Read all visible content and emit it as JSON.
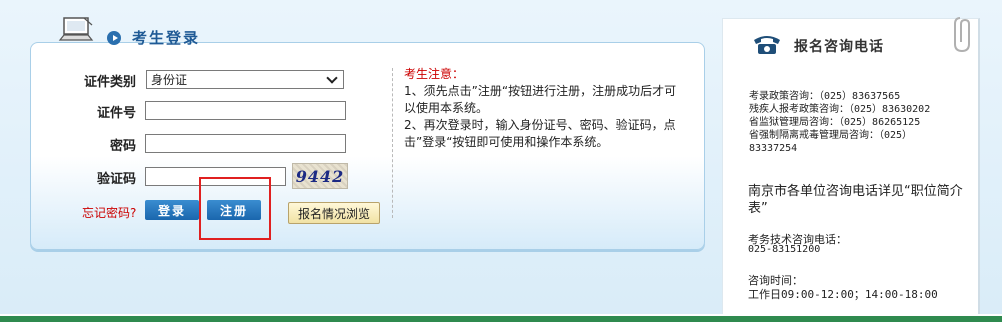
{
  "login": {
    "title": "考生登录",
    "fields": {
      "id_type_label": "证件类别",
      "id_type_value": "身份证",
      "id_number_label": "证件号",
      "password_label": "密码",
      "captcha_label": "验证码",
      "captcha_text": "9442"
    },
    "forgot_password": "忘记密码?",
    "login_button": "登录",
    "register_button": "注册",
    "browse_button": "报名情况浏览"
  },
  "notice": {
    "title": "考生注意：",
    "line1": "1、须先点击”注册“按钮进行注册，注册成功后才可以使用本系统。",
    "line2": "2、再次登录时，输入身份证号、密码、验证码，点击”登录“按钮即可使用和操作本系统。"
  },
  "contact": {
    "title": "报名咨询电话",
    "lines": [
      "考录政策咨询：（025）83637565",
      "残疾人报考政策咨询：（025）83630202",
      "省监狱管理局咨询：（025）86265125",
      "省强制隔离戒毒管理局咨询：（025）",
      "83337254"
    ],
    "note": "南京市各单位咨询电话详见“职位简介表”",
    "tech_label": "考务技术咨询电话：",
    "tech_phone": "025-83151200",
    "time_label": "咨询时间：",
    "time_value": "工作日09:00-12:00；14:00-18:00"
  },
  "colors": {
    "accent": "#1a66ad",
    "title": "#1f5a95",
    "warning": "#cc0000",
    "highlight": "#e02020"
  }
}
